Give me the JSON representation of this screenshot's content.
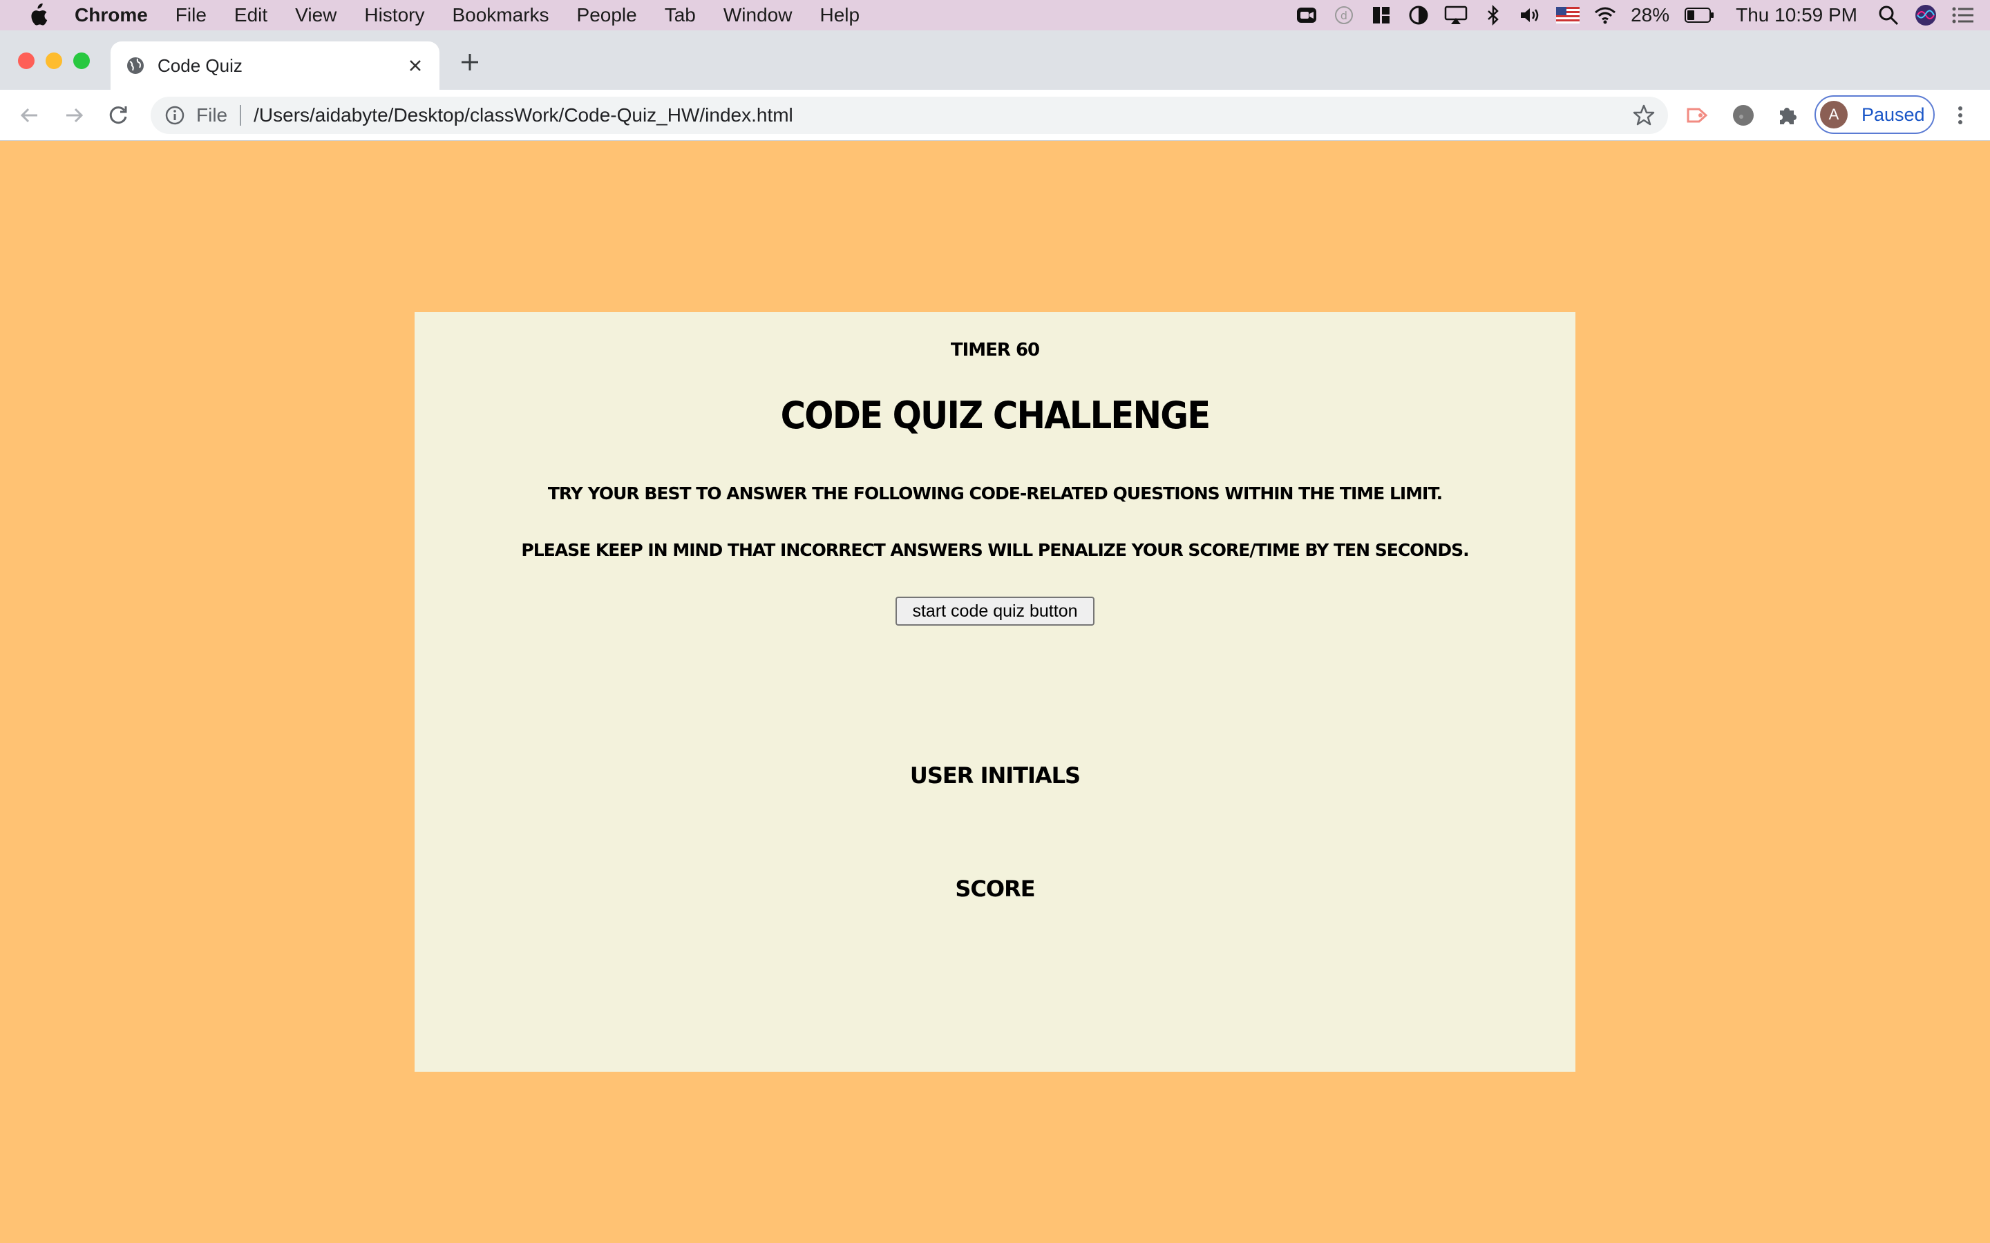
{
  "menubar": {
    "app_name": "Chrome",
    "items": [
      "File",
      "Edit",
      "View",
      "History",
      "Bookmarks",
      "People",
      "Tab",
      "Window",
      "Help"
    ],
    "battery": "28%",
    "clock": "Thu 10:59 PM"
  },
  "browser": {
    "tab_title": "Code Quiz",
    "url_scheme": "File",
    "url": "/Users/aidabyte/Desktop/classWork/Code-Quiz_HW/index.html",
    "profile_initial": "A",
    "profile_status": "Paused"
  },
  "page": {
    "timer": "Timer 60",
    "title": "Code Quiz Challenge",
    "instruction_1": "Try your best to answer the following code-related questions within the time limit.",
    "instruction_2": "Please keep in mind that incorrect answers will penalize your score/time by ten seconds.",
    "start_button": "start code quiz button",
    "initials_label": "User Initials",
    "score_label": "Score"
  },
  "colors": {
    "page_background": "#ffc273",
    "card_background": "#f3f2dc"
  }
}
